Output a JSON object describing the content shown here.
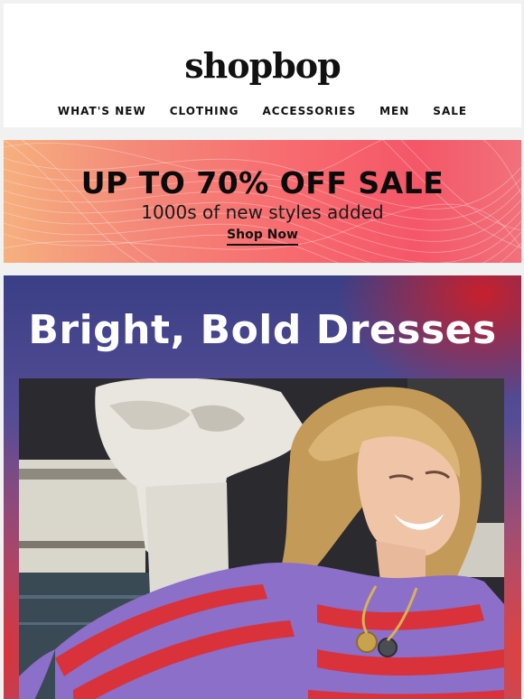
{
  "brand": {
    "logo_text": "shopbop"
  },
  "nav": {
    "items": [
      {
        "label": "WHAT'S NEW"
      },
      {
        "label": "CLOTHING"
      },
      {
        "label": "ACCESSORIES"
      },
      {
        "label": "MEN"
      },
      {
        "label": "SALE"
      }
    ]
  },
  "banner": {
    "title": "UP TO 70% OFF SALE",
    "subtitle": "1000s of new styles added",
    "cta_label": "Shop Now",
    "colors": {
      "left": "#f6b07e",
      "right": "#f45768"
    }
  },
  "hero": {
    "title": "Bright, Bold Dresses",
    "image_icon": "model-in-striped-sweater-image",
    "colors": {
      "background": "#5a4f97",
      "stripe_purple": "#8b6fc9",
      "stripe_red": "#d9323a"
    }
  }
}
